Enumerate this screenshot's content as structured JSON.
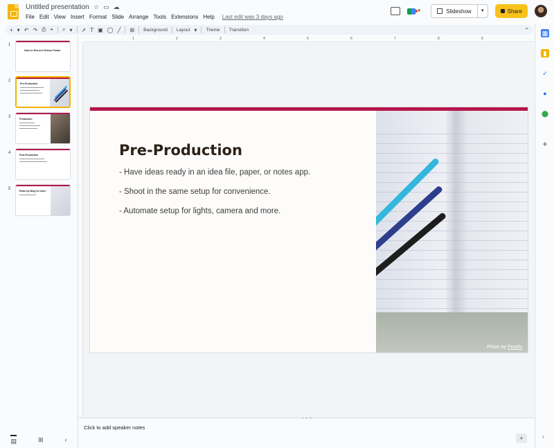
{
  "header": {
    "doc_title": "Untitled presentation",
    "menu": [
      "File",
      "Edit",
      "View",
      "Insert",
      "Format",
      "Slide",
      "Arrange",
      "Tools",
      "Extensions",
      "Help"
    ],
    "last_edit": "Last edit was 3 days ago",
    "slideshow_label": "Slideshow",
    "share_label": "Share"
  },
  "toolbar": {
    "background_label": "Background",
    "layout_label": "Layout",
    "theme_label": "Theme",
    "transition_label": "Transition"
  },
  "ruler": {
    "marks": [
      "1",
      "2",
      "3",
      "4",
      "5",
      "6",
      "7",
      "8",
      "9"
    ]
  },
  "slides": [
    {
      "num": "1",
      "title": "How to Record Videos Faster"
    },
    {
      "num": "2",
      "title": "Pre-Production"
    },
    {
      "num": "3",
      "title": "Production"
    },
    {
      "num": "4",
      "title": "Post-Production"
    },
    {
      "num": "5",
      "title": "Read my Blog for more"
    }
  ],
  "current_slide": {
    "title": "Pre-Production",
    "bullets": [
      "-  Have ideas ready in an idea file, paper, or notes app.",
      "-  Shoot in the same setup for convenience.",
      "-  Automate setup for lights, camera and more."
    ],
    "photo_credit_prefix": "Photo by ",
    "photo_credit_link": "Pexels"
  },
  "notes": {
    "placeholder": "Click to add speaker notes"
  },
  "colors": {
    "accent": "#b5164a",
    "share": "#f9c21a",
    "selected_thumb": "#f4b400"
  }
}
